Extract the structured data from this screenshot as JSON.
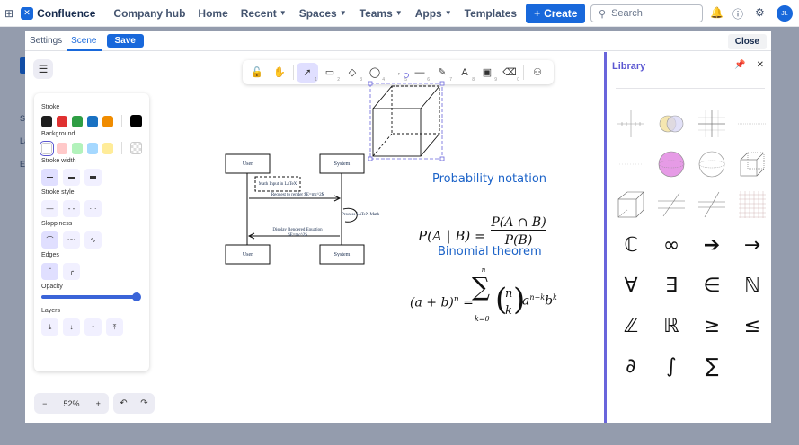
{
  "nav": {
    "brand": "Confluence",
    "items": [
      {
        "label": "Company hub",
        "dropdown": false
      },
      {
        "label": "Home",
        "dropdown": false
      },
      {
        "label": "Recent",
        "dropdown": true
      },
      {
        "label": "Spaces",
        "dropdown": true
      },
      {
        "label": "Teams",
        "dropdown": true
      },
      {
        "label": "Apps",
        "dropdown": true
      },
      {
        "label": "Templates",
        "dropdown": false
      }
    ],
    "create_label": "Create",
    "search_placeholder": "Search",
    "avatar_initials": "JL"
  },
  "bg": {
    "letters": [
      "S",
      "La",
      "E"
    ]
  },
  "modal": {
    "tabs": [
      "Settings",
      "Scene"
    ],
    "active_tab": "Scene",
    "save_label": "Save",
    "close_label": "Close"
  },
  "toolbar": {
    "tools": [
      {
        "name": "lock-icon",
        "glyph": "🔓",
        "key": ""
      },
      {
        "name": "hand-icon",
        "glyph": "✋",
        "key": ""
      },
      {
        "name": "selection-icon",
        "glyph": "➚",
        "key": "1",
        "active": true
      },
      {
        "name": "rectangle-icon",
        "glyph": "▭",
        "key": "2"
      },
      {
        "name": "diamond-icon",
        "glyph": "◇",
        "key": "3"
      },
      {
        "name": "ellipse-icon",
        "glyph": "◯",
        "key": "4"
      },
      {
        "name": "arrow-icon",
        "glyph": "→",
        "key": "5"
      },
      {
        "name": "line-icon",
        "glyph": "—",
        "key": "6"
      },
      {
        "name": "draw-icon",
        "glyph": "✎",
        "key": "7"
      },
      {
        "name": "text-icon",
        "glyph": "A",
        "key": "8"
      },
      {
        "name": "image-icon",
        "glyph": "▣",
        "key": "9"
      },
      {
        "name": "eraser-icon",
        "glyph": "⌫",
        "key": "0"
      },
      {
        "name": "more-tools-icon",
        "glyph": "⚇",
        "key": ""
      }
    ]
  },
  "props": {
    "stroke_label": "Stroke",
    "stroke_colors": [
      "#1e1e1e",
      "#e03131",
      "#2f9e44",
      "#1971c2",
      "#f08c00"
    ],
    "stroke_selected": "#000000",
    "background_label": "Background",
    "background_colors": [
      "#ffffff",
      "#ffc9c9",
      "#b2f2bb",
      "#a5d8ff",
      "#ffec99"
    ],
    "stroke_width_label": "Stroke width",
    "stroke_style_label": "Stroke style",
    "sloppiness_label": "Sloppiness",
    "edges_label": "Edges",
    "opacity_label": "Opacity",
    "opacity_value": 100,
    "layers_label": "Layers"
  },
  "zoom": {
    "minus": "−",
    "value": "52%",
    "plus": "+"
  },
  "library": {
    "title": "Library",
    "symbols": [
      "ℂ",
      "∞",
      "➔",
      "→",
      "∀",
      "∃",
      "∈",
      "ℕ",
      "ℤ",
      "ℝ",
      "≥",
      "≤",
      "∂",
      "∫",
      "∑"
    ]
  },
  "canvas": {
    "seq": {
      "actor_user": "User",
      "actor_system": "System",
      "note": "Math Input in LaTeX",
      "msg1": "Request to render $E=mc^2$",
      "self_msg": "Process LaTeX Math",
      "msg2a": "Display Rendered Equation",
      "msg2b": "$E=mc^2$"
    },
    "heading1": "Probability notation",
    "heading2": "Binomial theorem"
  }
}
